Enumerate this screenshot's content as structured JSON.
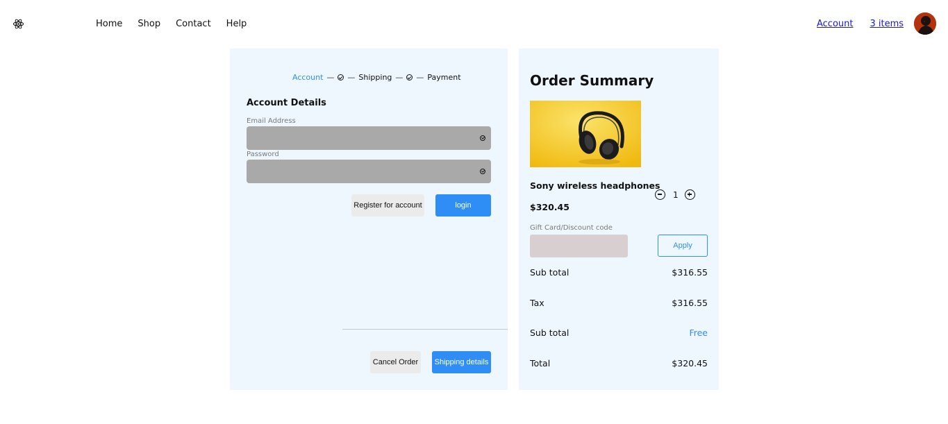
{
  "header": {
    "logo_icon": "react-atom-icon",
    "nav": [
      {
        "label": "Home"
      },
      {
        "label": "Shop"
      },
      {
        "label": "Contact"
      },
      {
        "label": "Help"
      }
    ],
    "account_link": "Account",
    "cart_link": "3 items"
  },
  "checkout": {
    "steps": [
      {
        "label": "Account",
        "state": "active"
      },
      {
        "label": "Shipping",
        "state": "complete"
      },
      {
        "label": "Payment",
        "state": "complete"
      }
    ],
    "section_title": "Account Details",
    "email_label": "Email Address",
    "password_label": "Password",
    "register_button": "Register for account",
    "login_button": "login",
    "cancel_button": "Cancel Order",
    "next_button": "Shipping details"
  },
  "summary": {
    "title": "Order Summary",
    "product_name": "Sony wireless headphones",
    "product_price": "$320.45",
    "quantity": "1",
    "gift_label": "Gift Card/Discount code",
    "apply_button": "Apply",
    "rows": [
      {
        "label": "Sub total",
        "value": "$316.55"
      },
      {
        "label": "Tax",
        "value": "$316.55"
      },
      {
        "label": "Sub total",
        "value": "Free"
      },
      {
        "label": "Total",
        "value": "$320.45"
      }
    ]
  },
  "colors": {
    "accent": "#2f8ef5",
    "panel_bg": "#eef6fe",
    "field_bg": "#a9a9a9",
    "product_bg": "#f3c21a"
  }
}
